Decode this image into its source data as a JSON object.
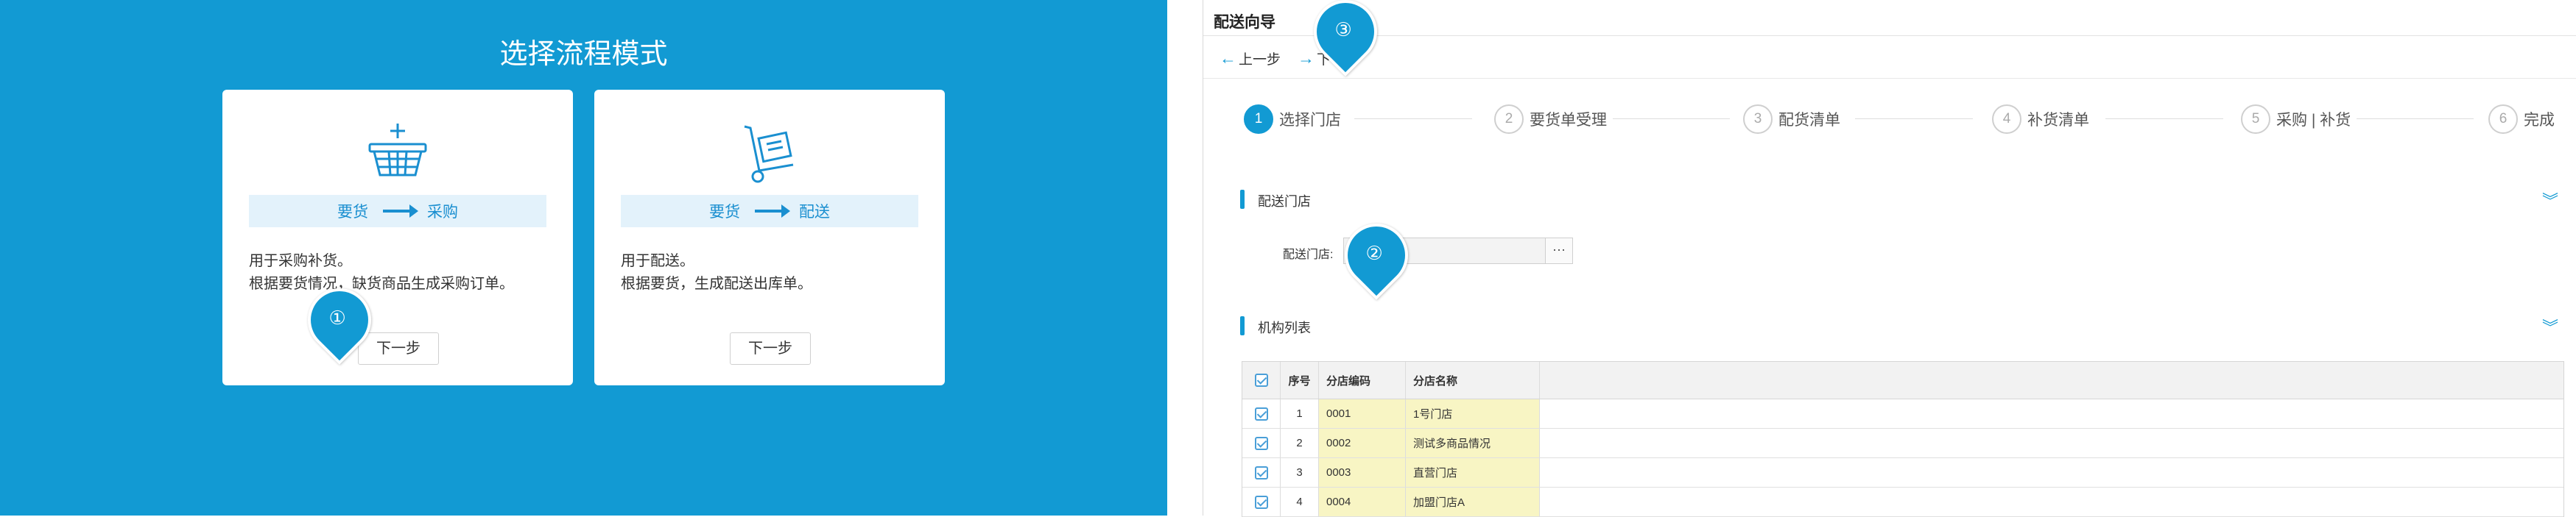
{
  "left_panel": {
    "title": "选择流程模式",
    "cards": [
      {
        "icon": "basket-add-icon",
        "flow_from": "要货",
        "flow_to": "采购",
        "desc_line1": "用于采购补货。",
        "desc_line2": "根据要货情况，缺货商品生成采购订单。",
        "button": "下一步"
      },
      {
        "icon": "hand-truck-icon",
        "flow_from": "要货",
        "flow_to": "配送",
        "desc_line1": "用于配送。",
        "desc_line2": "根据要货，生成配送出库单。",
        "button": "下一步"
      }
    ]
  },
  "markers": [
    "①",
    "②",
    "③"
  ],
  "wizard": {
    "title": "配送向导",
    "prev": "上一步",
    "next": "下一步",
    "steps": [
      {
        "num": "1",
        "label": "选择门店",
        "active": true
      },
      {
        "num": "2",
        "label": "要货单受理"
      },
      {
        "num": "3",
        "label": "配货清单"
      },
      {
        "num": "4",
        "label": "补货清单"
      },
      {
        "num": "5",
        "label": "采购 | 补货"
      },
      {
        "num": "6",
        "label": "完成"
      }
    ],
    "section_store": "配送门店",
    "store_field_label": "配送门店:",
    "store_field_value": "",
    "lookup_button": "···",
    "section_list": "机构列表",
    "table": {
      "headers": [
        "序号",
        "分店编码",
        "分店名称"
      ],
      "rows": [
        {
          "seq": "1",
          "code": "0001",
          "name": "1号门店"
        },
        {
          "seq": "2",
          "code": "0002",
          "name": "测试多商品情况"
        },
        {
          "seq": "3",
          "code": "0003",
          "name": "直营门店"
        },
        {
          "seq": "4",
          "code": "0004",
          "name": "加盟门店A"
        }
      ]
    }
  },
  "colors": {
    "accent": "#129ad3",
    "highlight": "#f8f5c4"
  }
}
